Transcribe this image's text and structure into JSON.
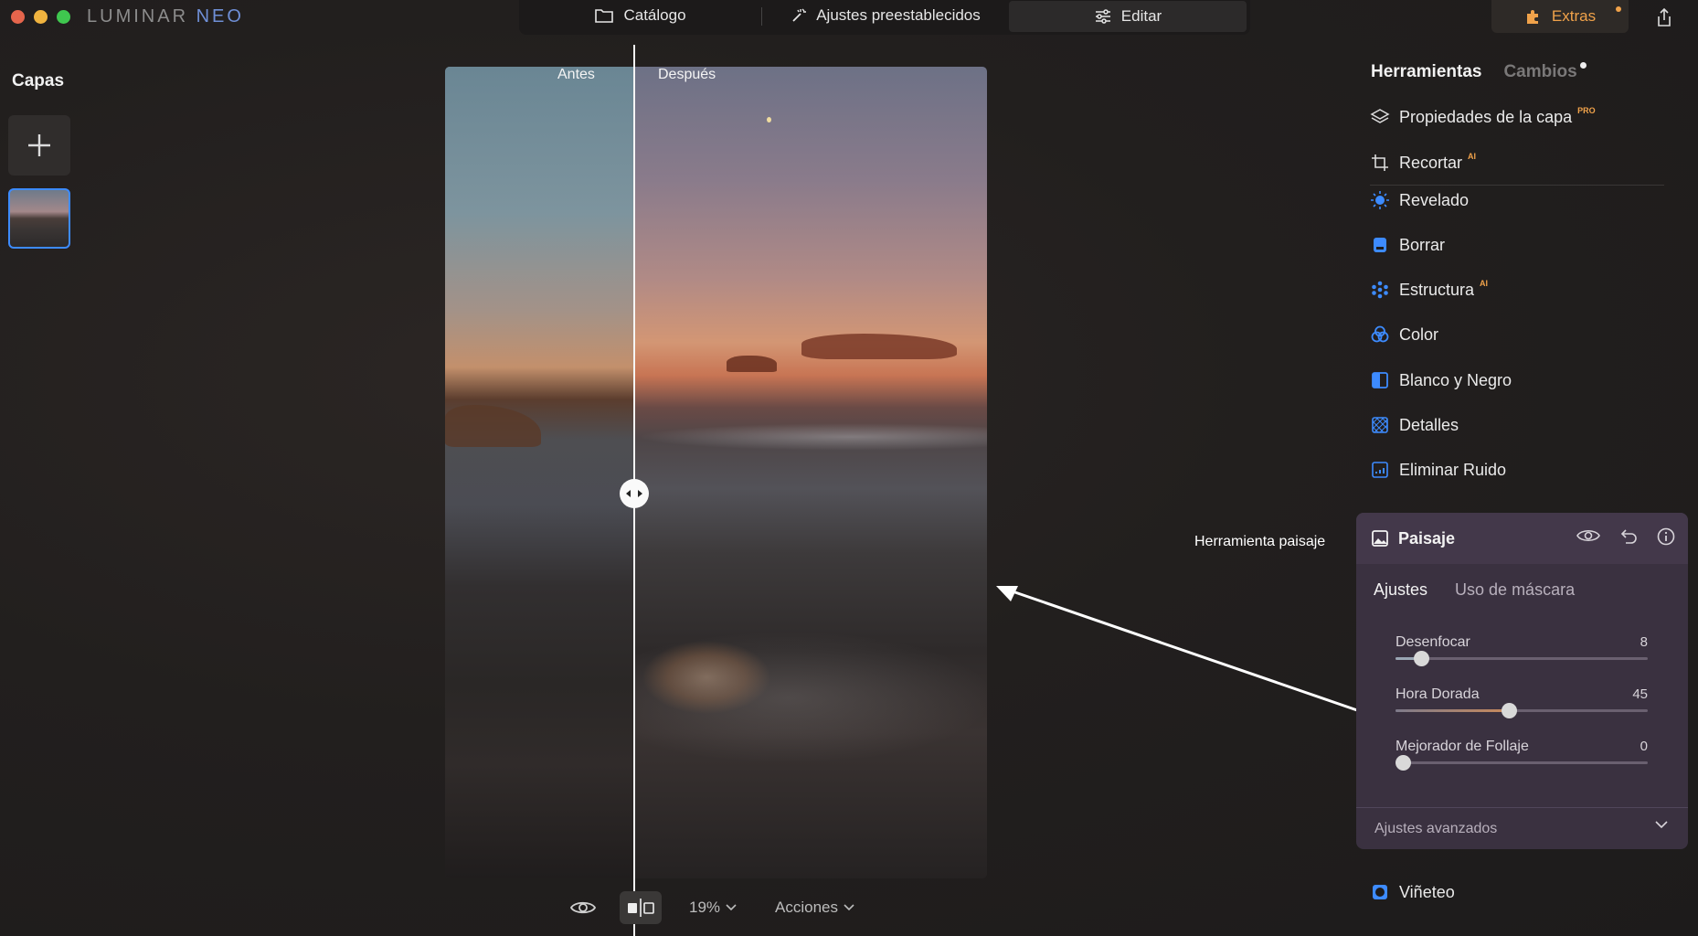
{
  "app": {
    "brand_main": "LUMINAR",
    "brand_accent": "NEO",
    "traffic_colors": [
      "#e5654c",
      "#f0b33f",
      "#3fc74f"
    ]
  },
  "nav": {
    "catalog": "Catálogo",
    "presets": "Ajustes preestablecidos",
    "edit": "Editar",
    "extras": "Extras"
  },
  "layers": {
    "title": "Capas"
  },
  "canvas": {
    "before_label": "Antes",
    "after_label": "Después"
  },
  "bottom_bar": {
    "zoom": "19%",
    "actions": "Acciones"
  },
  "annotation": {
    "text": "Herramienta paisaje"
  },
  "right_panel": {
    "tabs": {
      "tools": "Herramientas",
      "changes": "Cambios"
    },
    "tools": [
      {
        "label": "Propiedades de la capa",
        "badge": "PRO",
        "icon": "layers-icon"
      },
      {
        "label": "Recortar",
        "badge": "AI",
        "icon": "crop-icon"
      },
      {
        "label": "Revelado",
        "badge": "",
        "icon": "sun-icon"
      },
      {
        "label": "Borrar",
        "badge": "",
        "icon": "eraser-icon"
      },
      {
        "label": "Estructura",
        "badge": "AI",
        "icon": "structure-icon"
      },
      {
        "label": "Color",
        "badge": "",
        "icon": "color-icon"
      },
      {
        "label": "Blanco y Negro",
        "badge": "",
        "icon": "bw-icon"
      },
      {
        "label": "Detalles",
        "badge": "",
        "icon": "details-icon"
      },
      {
        "label": "Eliminar Ruido",
        "badge": "",
        "icon": "noise-icon"
      }
    ],
    "landscape": {
      "title": "Paisaje",
      "tab_adjust": "Ajustes",
      "tab_mask": "Uso de máscara",
      "sliders": [
        {
          "label": "Desenfocar",
          "value": "8",
          "fraction": 0.1
        },
        {
          "label": "Hora Dorada",
          "value": "45",
          "fraction": 0.45
        },
        {
          "label": "Mejorador de Follaje",
          "value": "0",
          "fraction": 0.0
        }
      ],
      "advanced": "Ajustes avanzados"
    },
    "vignette": "Viñeteo"
  },
  "colors": {
    "accent_blue": "#3d8bff",
    "extras_orange": "#f0a24a",
    "panel_bg": "#3a3140"
  }
}
